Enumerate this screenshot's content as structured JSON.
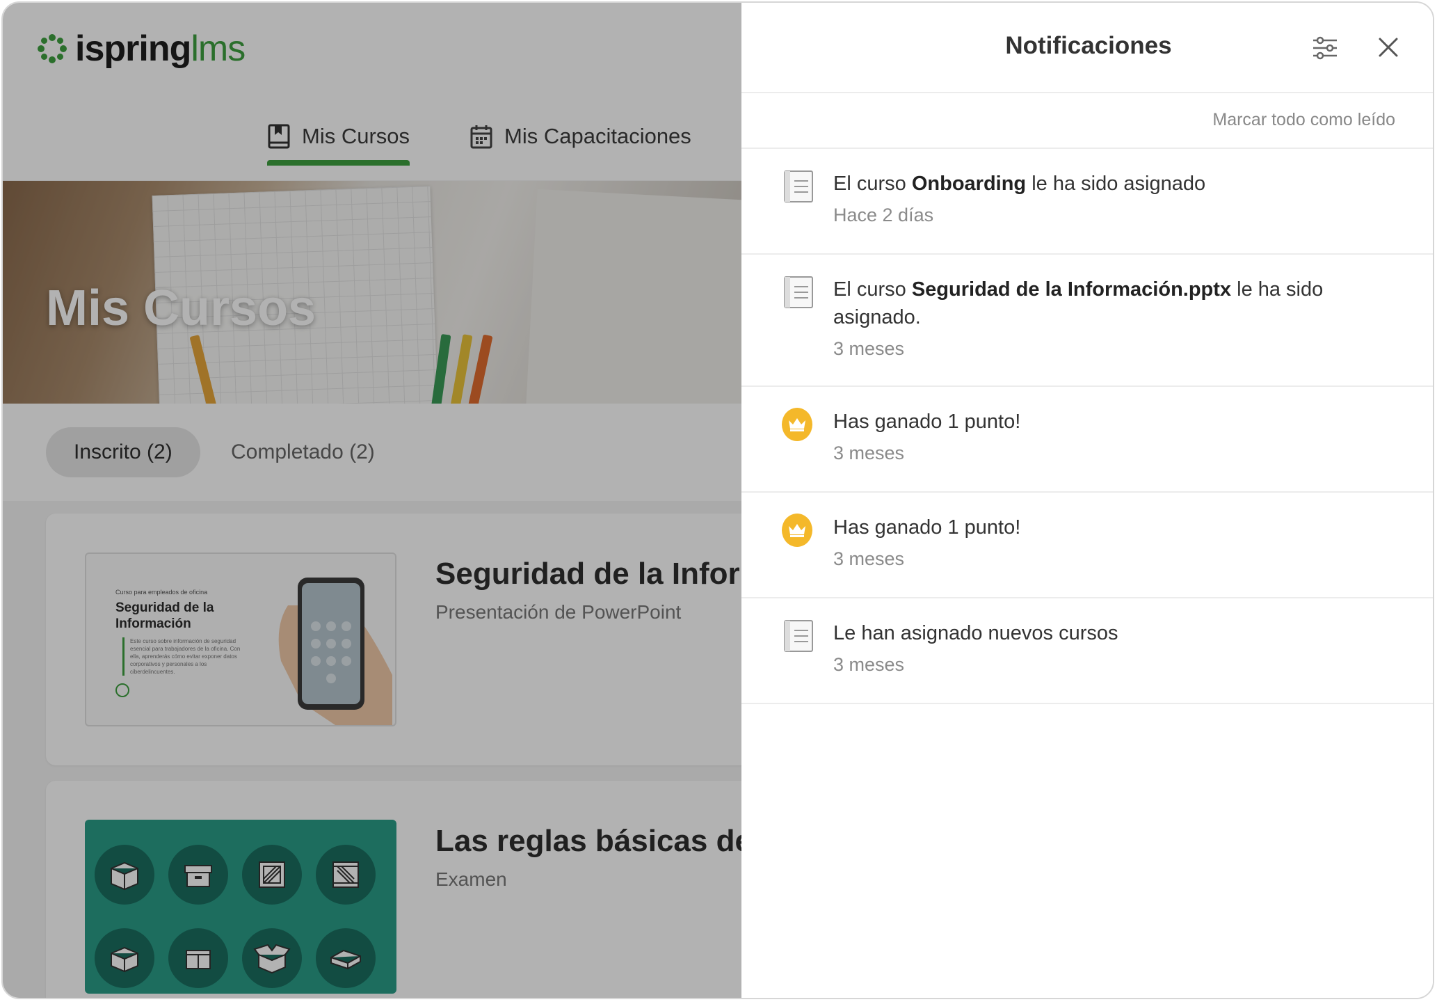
{
  "app": {
    "logo_word": "ispring",
    "logo_suffix": "lms",
    "brand_color": "#3ea040"
  },
  "nav": {
    "items": [
      {
        "label": "Mis Cursos",
        "icon": "book-icon",
        "active": true
      },
      {
        "label": "Mis Capacitaciones",
        "icon": "calendar-icon",
        "active": false
      }
    ]
  },
  "hero": {
    "title": "Mis Cursos"
  },
  "filters": {
    "enrolled": "Inscrito (2)",
    "completed": "Completado (2)"
  },
  "courses": [
    {
      "title": "Seguridad de la Inform",
      "subtitle": "Presentación de PowerPoint",
      "thumb_kicker": "Curso para empleados de oficina",
      "thumb_title": "Seguridad de la Información",
      "thumb_desc": "Este curso sobre información de seguridad esencial para trabajadores de la oficina. Con ella, aprenderás cómo evitar exponer datos corporativos y personales a los ciberdelincuentes."
    },
    {
      "title": "Las reglas básicas de l",
      "subtitle": "Examen"
    }
  ],
  "panel": {
    "title": "Notificaciones",
    "mark_all": "Marcar todo como leído",
    "notifications": [
      {
        "icon": "document-icon",
        "pre": "El curso ",
        "bold": "Onboarding",
        "post": " le ha sido asignado",
        "time": "Hace 2 días"
      },
      {
        "icon": "document-icon",
        "pre": "El curso ",
        "bold": "Seguridad de la Información.pptx",
        "post": " le ha sido asignado.",
        "time": "3 meses"
      },
      {
        "icon": "crown-icon",
        "pre": "Has ganado 1 punto!",
        "bold": "",
        "post": "",
        "time": "3 meses"
      },
      {
        "icon": "crown-icon",
        "pre": "Has ganado 1 punto!",
        "bold": "",
        "post": "",
        "time": "3 meses"
      },
      {
        "icon": "document-icon",
        "pre": "Le han asignado nuevos cursos",
        "bold": "",
        "post": "",
        "time": "3 meses"
      }
    ],
    "crown_color": "#f4b82a"
  }
}
